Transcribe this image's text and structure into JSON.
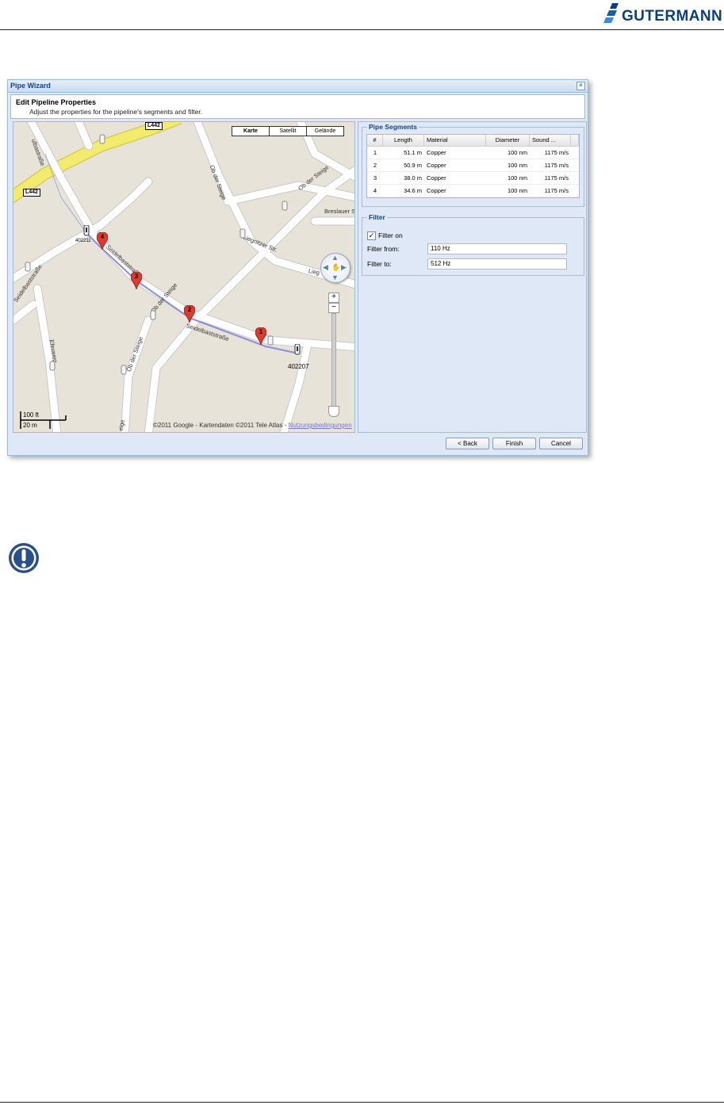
{
  "brand": {
    "name": "GUTERMANN",
    "color": "#0d3f7a"
  },
  "dialog": {
    "title": "Pipe Wizard",
    "close_icon": "close-icon",
    "step_title": "Edit Pipeline Properties",
    "step_description": "Adjust the properties for the pipeline's segments and filter."
  },
  "map": {
    "types": [
      "Karte",
      "Satellit",
      "Gelände"
    ],
    "active_type": "Karte",
    "roads": {
      "l442_a": "L442",
      "l442_b": "L442",
      "seidelbast_1": "Seidelbaststraße",
      "seidelbast_2": "Seidelbaststraße",
      "ob_der_steige_1": "Ob der Steige",
      "ob_der_steige_2": "Ob der Steige",
      "ob_der_steige_3": "Ob der Steige",
      "ob_der_steige_4": "Ob der Steige",
      "liegnitzer": "Liegnitzer Str.",
      "liegnitzer_2": "Lieg",
      "breslauer": "Breslauer S",
      "efeuweg": "Efeuweg",
      "ulbastr": "ulbastraße",
      "seidelbast_left": "Seidelbaststraße",
      "steige_bottom": "eige"
    },
    "pins": [
      "1",
      "2",
      "3",
      "4"
    ],
    "sensor_label": "402207",
    "sensor_label_2": "402211",
    "scale": {
      "feet": "100 ft",
      "meters": "20 m"
    },
    "copyright": "©2011 Google - Kartendaten ©2011 Tele Atlas - ",
    "terms_link": "Nutzungsbedingungen"
  },
  "segments": {
    "legend": "Pipe Segments",
    "columns": [
      "#",
      "Length",
      "Material",
      "Diameter",
      "Sound ..."
    ],
    "rows": [
      {
        "num": "1",
        "length": "51.1 m",
        "material": "Copper",
        "diameter": "100 nm",
        "sound": "1175 m/s"
      },
      {
        "num": "2",
        "length": "50.9 m",
        "material": "Copper",
        "diameter": "100 nm",
        "sound": "1175 m/s"
      },
      {
        "num": "3",
        "length": "38.0 m",
        "material": "Copper",
        "diameter": "100 nm",
        "sound": "1175 m/s"
      },
      {
        "num": "4",
        "length": "34.6 m",
        "material": "Copper",
        "diameter": "100 nm",
        "sound": "1175 m/s"
      }
    ]
  },
  "filter": {
    "legend": "Filter",
    "checkbox_label": "Filter on",
    "checked": true,
    "from_label": "Filter from:",
    "from_value": "110 Hz",
    "to_label": "Filter to:",
    "to_value": "512 Hz"
  },
  "buttons": {
    "back": "< Back",
    "finish": "Finish",
    "cancel": "Cancel"
  },
  "colors": {
    "accent": "#15428b",
    "pin_red": "#e03a2f",
    "route": "#8b8fd8",
    "highway": "#f2eb6e"
  }
}
